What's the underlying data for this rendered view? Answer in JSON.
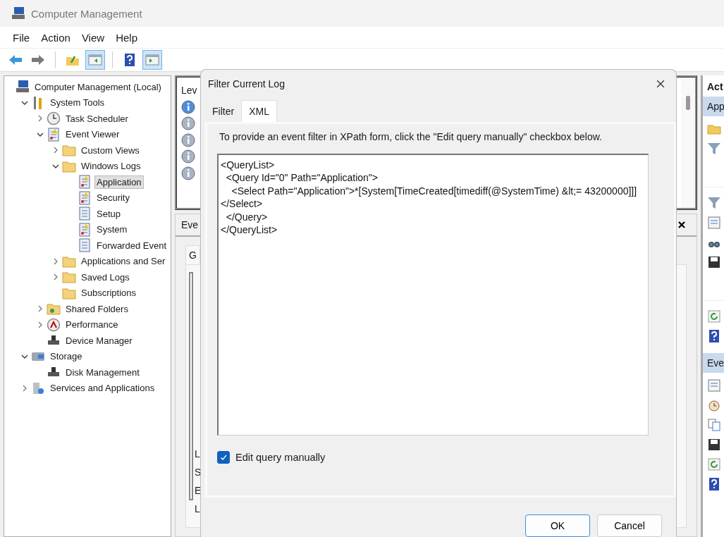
{
  "window": {
    "title": "Computer Management"
  },
  "menu": [
    "File",
    "Action",
    "View",
    "Help"
  ],
  "toolbar": [
    {
      "kind": "back",
      "selected": false
    },
    {
      "kind": "forward",
      "selected": false
    },
    {
      "kind": "up",
      "selected": false
    },
    {
      "kind": "tree-toggle",
      "selected": true
    },
    {
      "kind": "help",
      "selected": false
    },
    {
      "kind": "pane-toggle",
      "selected": true
    }
  ],
  "tree": [
    {
      "label": "Computer Management (Local)",
      "kind": "computer",
      "selected": false,
      "children": [
        {
          "label": "System Tools",
          "kind": "tools",
          "expanded": true,
          "selected": false,
          "children": [
            {
              "label": "Task Scheduler",
              "kind": "clock",
              "expanded": false,
              "selected": false
            },
            {
              "label": "Event Viewer",
              "kind": "viewer",
              "expanded": true,
              "selected": false,
              "children": [
                {
                  "label": "Custom Views",
                  "kind": "folder",
                  "expanded": false,
                  "selected": false
                },
                {
                  "label": "Windows Logs",
                  "kind": "folder",
                  "expanded": true,
                  "selected": false,
                  "children": [
                    {
                      "label": "Application",
                      "kind": "log-warn",
                      "selected": true
                    },
                    {
                      "label": "Security",
                      "kind": "log-warn",
                      "selected": false
                    },
                    {
                      "label": "Setup",
                      "kind": "log",
                      "selected": false
                    },
                    {
                      "label": "System",
                      "kind": "log-warn",
                      "selected": false
                    },
                    {
                      "label": "Forwarded Event",
                      "kind": "log",
                      "selected": false
                    }
                  ]
                },
                {
                  "label": "Applications and Ser",
                  "kind": "folder",
                  "expanded": false,
                  "selected": false
                },
                {
                  "label": "Saved Logs",
                  "kind": "folder",
                  "expanded": false,
                  "selected": false
                },
                {
                  "label": "Subscriptions",
                  "kind": "folder",
                  "selected": false
                }
              ]
            },
            {
              "label": "Shared Folders",
              "kind": "shared",
              "expanded": false,
              "selected": false
            },
            {
              "label": "Performance",
              "kind": "gauge",
              "expanded": false,
              "selected": false
            },
            {
              "label": "Device Manager",
              "kind": "device",
              "selected": false
            }
          ]
        },
        {
          "label": "Storage",
          "kind": "storage",
          "expanded": true,
          "selected": false,
          "children": [
            {
              "label": "Disk Management",
              "kind": "disk",
              "selected": false
            }
          ]
        },
        {
          "label": "Services and Applications",
          "kind": "services",
          "expanded": false,
          "selected": false
        }
      ]
    }
  ],
  "events": {
    "header": "Lev",
    "rows": [
      {
        "selected": true
      },
      {
        "selected": false
      },
      {
        "selected": false
      },
      {
        "selected": false
      },
      {
        "selected": false
      }
    ]
  },
  "details": {
    "title": "Eve",
    "tab": "G",
    "fields": [
      "L",
      "S",
      "E",
      "L"
    ]
  },
  "actions": {
    "title": "Act",
    "sections": [
      {
        "title": "App",
        "items": [
          {
            "kind": "folder"
          },
          {
            "kind": "funnel"
          },
          {
            "kind": "separator"
          },
          {
            "kind": "funnel"
          },
          {
            "kind": "doc"
          },
          {
            "kind": "binoculars"
          },
          {
            "kind": "floppy"
          },
          {
            "kind": "separator"
          },
          {
            "kind": "refresh"
          },
          {
            "kind": "help"
          }
        ]
      },
      {
        "title": "Eve",
        "items": [
          {
            "kind": "doc"
          },
          {
            "kind": "clock"
          },
          {
            "kind": "copy"
          },
          {
            "kind": "floppy"
          },
          {
            "kind": "refresh"
          },
          {
            "kind": "help"
          }
        ]
      }
    ]
  },
  "dialog": {
    "title": "Filter Current Log",
    "tabs": [
      {
        "label": "Filter",
        "selected": false
      },
      {
        "label": "XML",
        "selected": true
      }
    ],
    "instruction": "To provide an event filter in XPath form, click the \"Edit query manually\" checkbox below.",
    "query": [
      "<QueryList>",
      "  <Query Id=\"0\" Path=\"Application\">",
      "    <Select Path=\"Application\">*[System[TimeCreated[timediff(@SystemTime) &lt;= 43200000]]]</Select>",
      "  </Query>",
      "</QueryList>"
    ],
    "edit_manually": {
      "label": "Edit query manually",
      "checked": true
    },
    "buttons": [
      "OK",
      "Cancel"
    ]
  }
}
